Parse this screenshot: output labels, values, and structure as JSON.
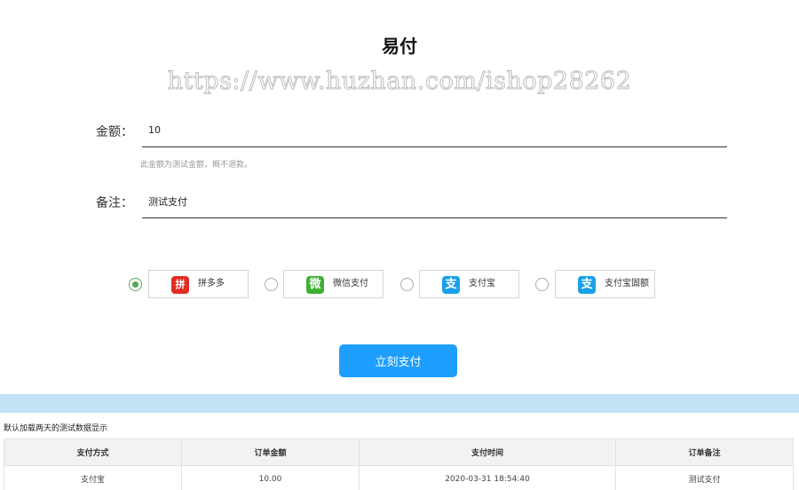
{
  "page": {
    "title": "易付",
    "watermark": "https://www.huzhan.com/ishop28262"
  },
  "form": {
    "amount": {
      "label": "金额：",
      "value": "10",
      "hint": "此金额为测试金额，概不退款。"
    },
    "remark": {
      "label": "备注：",
      "value": "测试支付"
    }
  },
  "payment_methods": [
    {
      "label": "拼多多",
      "icon": "pinduoduo-icon",
      "icon_glyph": "拼",
      "selected": true
    },
    {
      "label": "微信支付",
      "icon": "wechat-pay-icon",
      "icon_glyph": "微",
      "selected": false
    },
    {
      "label": "支付宝",
      "icon": "alipay-icon",
      "icon_glyph": "支",
      "selected": false
    },
    {
      "label": "支付宝固额",
      "icon": "alipay-fixed-icon",
      "icon_glyph": "支",
      "selected": false
    }
  ],
  "submit_label": "立刻支付",
  "colors": {
    "primary": "#1e9fff",
    "band": "#c3e3f4",
    "radio_checked": "#5aa55a"
  },
  "table": {
    "note": "默认加载两天的测试数据显示",
    "headers": [
      "支付方式",
      "订单金额",
      "支付时间",
      "订单备注"
    ],
    "rows": [
      [
        "支付宝",
        "10.00",
        "2020-03-31 18:54:40",
        "测试支付"
      ]
    ]
  }
}
